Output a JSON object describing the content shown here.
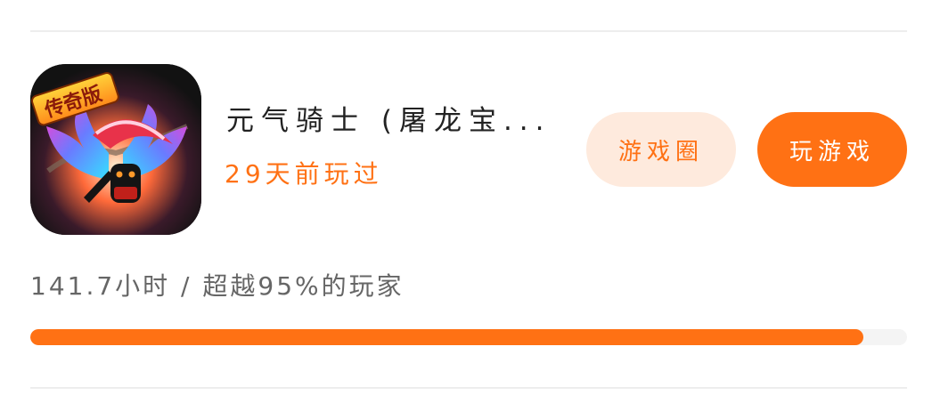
{
  "game": {
    "title": "元气骑士 (屠龙宝...",
    "last_played": "29天前玩过",
    "icon_name": "soul-knight-legend-edition-icon",
    "icon_badge": "传奇版"
  },
  "buttons": {
    "game_circle_label": "游戏圈",
    "play_label": "玩游戏"
  },
  "stats": {
    "summary": "141.7小时 / 超越95%的玩家",
    "progress_fraction": 0.95
  },
  "colors": {
    "accent": "#ff7114",
    "accent_light": "#feeadd",
    "progress_track": "#f4f4f4"
  }
}
